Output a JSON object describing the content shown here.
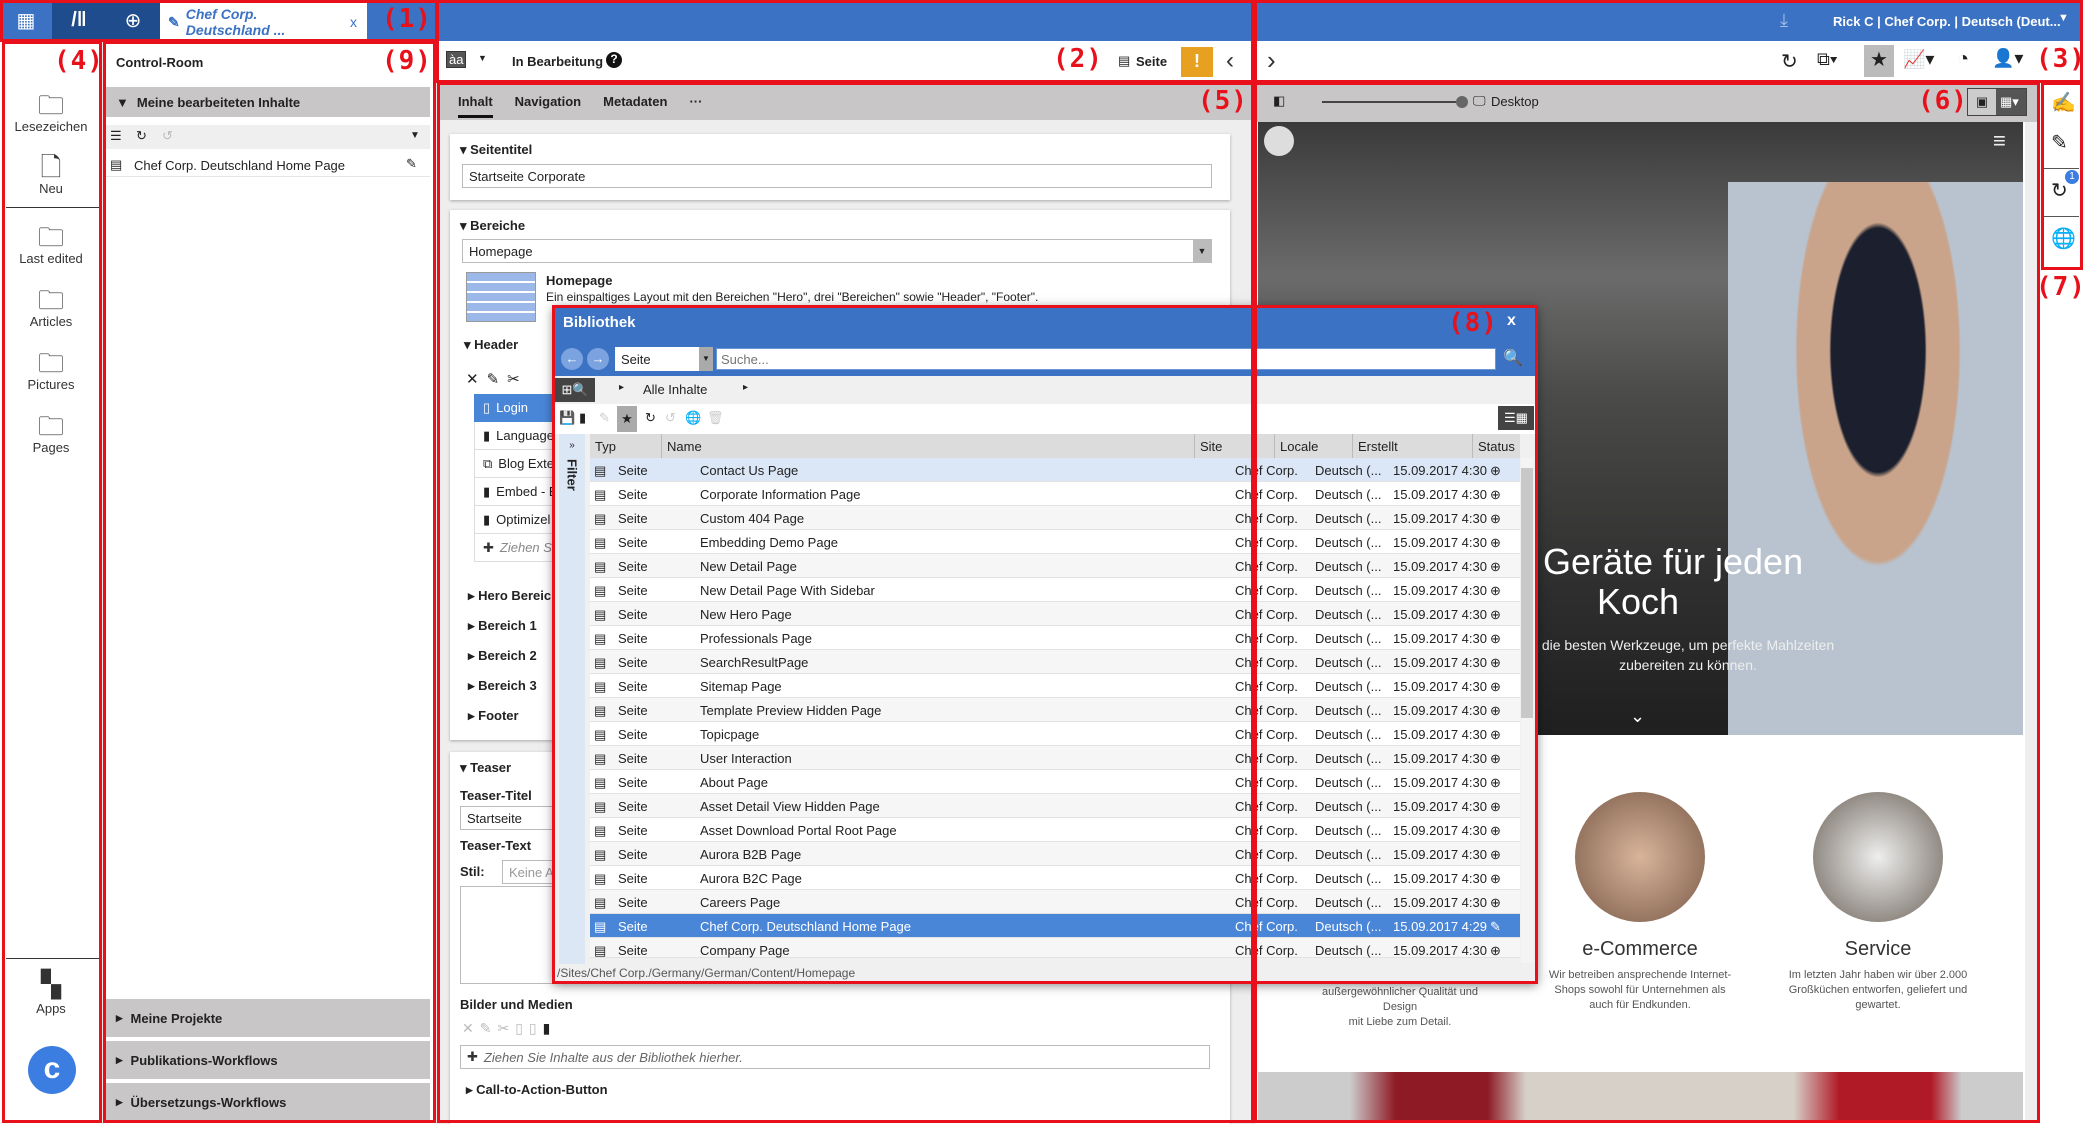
{
  "topbar": {
    "tab_label": "Chef Corp. Deutschland ...",
    "tab_close": "x",
    "user_info": "Rick C | Chef Corp. | Deutsch (Deut...",
    "accent": "#3b72c4"
  },
  "toolbar": {
    "status": "In Bearbeitung",
    "help": "?",
    "view_label": "Seite",
    "lang_icon": "àa"
  },
  "annotations": [
    "(1)",
    "(2)",
    "(3)",
    "(4)",
    "(5)",
    "(6)",
    "(7)",
    "(8)",
    "(9)"
  ],
  "sidebar": {
    "items": [
      {
        "label": "Lesezeichen"
      },
      {
        "label": "Neu"
      },
      {
        "label": "Last edited"
      },
      {
        "label": "Articles"
      },
      {
        "label": "Pictures"
      },
      {
        "label": "Pages"
      }
    ],
    "apps": "Apps"
  },
  "control_room": {
    "title": "Control-Room",
    "section": "Meine bearbeiteten Inhalte",
    "item": "Chef Corp. Deutschland Home Page",
    "bottom": [
      "Meine Projekte",
      "Publikations-Workflows",
      "Übersetzungs-Workflows"
    ]
  },
  "form": {
    "tabs": [
      "Inhalt",
      "Navigation",
      "Metadaten",
      "···"
    ],
    "seitentitel_label": "Seitentitel",
    "seitentitel_value": "Startseite Corporate",
    "bereiche_label": "Bereiche",
    "bereiche_value": "Homepage",
    "layout_title": "Homepage",
    "layout_desc": "Ein einspaltiges Layout mit den Bereichen \"Hero\", drei \"Bereichen\" sowie \"Header\", \"Footer\".",
    "header_label": "Header",
    "header_items": [
      "Login",
      "Language",
      "Blog Exte",
      "Embed - E",
      "Optimizel"
    ],
    "drop_short": "Ziehen Sie",
    "sections": [
      "Hero Bereich",
      "Bereich 1",
      "Bereich 2",
      "Bereich 3",
      "Footer"
    ],
    "teaser_label": "Teaser",
    "teaser_title_label": "Teaser-Titel",
    "teaser_title_value": "Startseite",
    "teaser_text_label": "Teaser-Text",
    "stil_label": "Stil:",
    "stil_value": "Keine A",
    "media_label": "Bilder und Medien",
    "media_drop": "Ziehen Sie Inhalte aus der Bibliothek hierher.",
    "cta_label": "Call-to-Action-Button"
  },
  "preview": {
    "device": "Desktop",
    "hero_line1": "und Geräte für jeden",
    "hero_line2": "Koch",
    "hero_sub1": "die besten Werkzeuge, um perfekte Mahlzeiten",
    "hero_sub2": "zubereiten zu können.",
    "left_desc1": "außergewöhnlicher Qualität und Design",
    "left_desc2": "mit Liebe zum Detail.",
    "features": [
      {
        "title": "e-Commerce",
        "desc": [
          "Wir betreiben ansprechende Internet-",
          "Shops sowohl für Unternehmen als",
          "auch für Endkunden."
        ]
      },
      {
        "title": "Service",
        "desc": [
          "Im letzten Jahr haben wir über 2.000",
          "Großküchen entworfen, geliefert und",
          "gewartet."
        ]
      }
    ]
  },
  "strip": {
    "badge": "1"
  },
  "library": {
    "title": "Bibliothek",
    "close": "x",
    "type_value": "Seite",
    "search_placeholder": "Suche...",
    "breadcrumb": "Alle Inhalte",
    "filter": "Filter",
    "columns": [
      "Typ",
      "Name",
      "Site",
      "Locale",
      "Erstellt",
      "Status"
    ],
    "rows": [
      {
        "typ": "Seite",
        "name": "Contact Us Page",
        "site": "Chef Corp.",
        "locale": "Deutsch (...",
        "created": "15.09.2017 4:30",
        "status": "globe-icon",
        "state": "hover"
      },
      {
        "typ": "Seite",
        "name": "Corporate Information Page",
        "site": "Chef Corp.",
        "locale": "Deutsch (...",
        "created": "15.09.2017 4:30",
        "status": "globe-icon"
      },
      {
        "typ": "Seite",
        "name": "Custom 404 Page",
        "site": "Chef Corp.",
        "locale": "Deutsch (...",
        "created": "15.09.2017 4:30",
        "status": "globe-icon"
      },
      {
        "typ": "Seite",
        "name": "Embedding Demo Page",
        "site": "Chef Corp.",
        "locale": "Deutsch (...",
        "created": "15.09.2017 4:30",
        "status": "globe-icon"
      },
      {
        "typ": "Seite",
        "name": "New Detail Page",
        "site": "Chef Corp.",
        "locale": "Deutsch (...",
        "created": "15.09.2017 4:30",
        "status": "globe-icon"
      },
      {
        "typ": "Seite",
        "name": "New Detail Page With Sidebar",
        "site": "Chef Corp.",
        "locale": "Deutsch (...",
        "created": "15.09.2017 4:30",
        "status": "globe-icon"
      },
      {
        "typ": "Seite",
        "name": "New Hero Page",
        "site": "Chef Corp.",
        "locale": "Deutsch (...",
        "created": "15.09.2017 4:30",
        "status": "globe-icon"
      },
      {
        "typ": "Seite",
        "name": "Professionals Page",
        "site": "Chef Corp.",
        "locale": "Deutsch (...",
        "created": "15.09.2017 4:30",
        "status": "globe-icon"
      },
      {
        "typ": "Seite",
        "name": "SearchResultPage",
        "site": "Chef Corp.",
        "locale": "Deutsch (...",
        "created": "15.09.2017 4:30",
        "status": "globe-icon"
      },
      {
        "typ": "Seite",
        "name": "Sitemap Page",
        "site": "Chef Corp.",
        "locale": "Deutsch (...",
        "created": "15.09.2017 4:30",
        "status": "globe-icon"
      },
      {
        "typ": "Seite",
        "name": "Template Preview Hidden Page",
        "site": "Chef Corp.",
        "locale": "Deutsch (...",
        "created": "15.09.2017 4:30",
        "status": "globe-icon"
      },
      {
        "typ": "Seite",
        "name": "Topicpage",
        "site": "Chef Corp.",
        "locale": "Deutsch (...",
        "created": "15.09.2017 4:30",
        "status": "globe-icon"
      },
      {
        "typ": "Seite",
        "name": "User Interaction",
        "site": "Chef Corp.",
        "locale": "Deutsch (...",
        "created": "15.09.2017 4:30",
        "status": "globe-icon"
      },
      {
        "typ": "Seite",
        "name": "About Page",
        "site": "Chef Corp.",
        "locale": "Deutsch (...",
        "created": "15.09.2017 4:30",
        "status": "globe-icon"
      },
      {
        "typ": "Seite",
        "name": "Asset Detail View Hidden Page",
        "site": "Chef Corp.",
        "locale": "Deutsch (...",
        "created": "15.09.2017 4:30",
        "status": "globe-icon"
      },
      {
        "typ": "Seite",
        "name": "Asset Download Portal Root Page",
        "site": "Chef Corp.",
        "locale": "Deutsch (...",
        "created": "15.09.2017 4:30",
        "status": "globe-icon"
      },
      {
        "typ": "Seite",
        "name": "Aurora B2B Page",
        "site": "Chef Corp.",
        "locale": "Deutsch (...",
        "created": "15.09.2017 4:30",
        "status": "globe-icon"
      },
      {
        "typ": "Seite",
        "name": "Aurora B2C Page",
        "site": "Chef Corp.",
        "locale": "Deutsch (...",
        "created": "15.09.2017 4:30",
        "status": "globe-icon"
      },
      {
        "typ": "Seite",
        "name": "Careers Page",
        "site": "Chef Corp.",
        "locale": "Deutsch (...",
        "created": "15.09.2017 4:30",
        "status": "globe-icon"
      },
      {
        "typ": "Seite",
        "name": "Chef Corp. Deutschland Home Page",
        "site": "Chef Corp.",
        "locale": "Deutsch (...",
        "created": "15.09.2017 4:29",
        "status": "pencil-icon",
        "state": "selected"
      },
      {
        "typ": "Seite",
        "name": "Company Page",
        "site": "Chef Corp.",
        "locale": "Deutsch (...",
        "created": "15.09.2017 4:30",
        "status": "globe-icon"
      }
    ],
    "path": "/Sites/Chef Corp./Germany/German/Content/Homepage"
  }
}
